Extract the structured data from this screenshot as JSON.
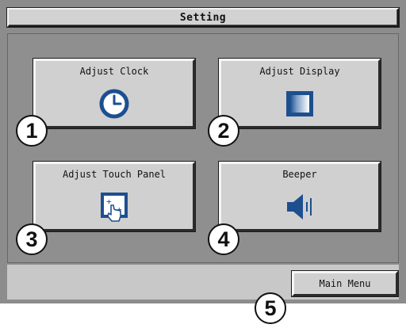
{
  "header": {
    "title": "Setting"
  },
  "tiles": [
    {
      "label": "Adjust Clock",
      "icon": "clock-icon"
    },
    {
      "label": "Adjust Display",
      "icon": "display-icon"
    },
    {
      "label": "Adjust Touch Panel",
      "icon": "touch-panel-icon"
    },
    {
      "label": "Beeper",
      "icon": "speaker-icon"
    }
  ],
  "badges": [
    "1",
    "2",
    "3",
    "4",
    "5"
  ],
  "footer": {
    "main_menu_label": "Main Menu"
  },
  "colors": {
    "screen_bg": "#8c8c8c",
    "button_face": "#d0d0d0",
    "icon_blue": "#1d4f8f"
  }
}
